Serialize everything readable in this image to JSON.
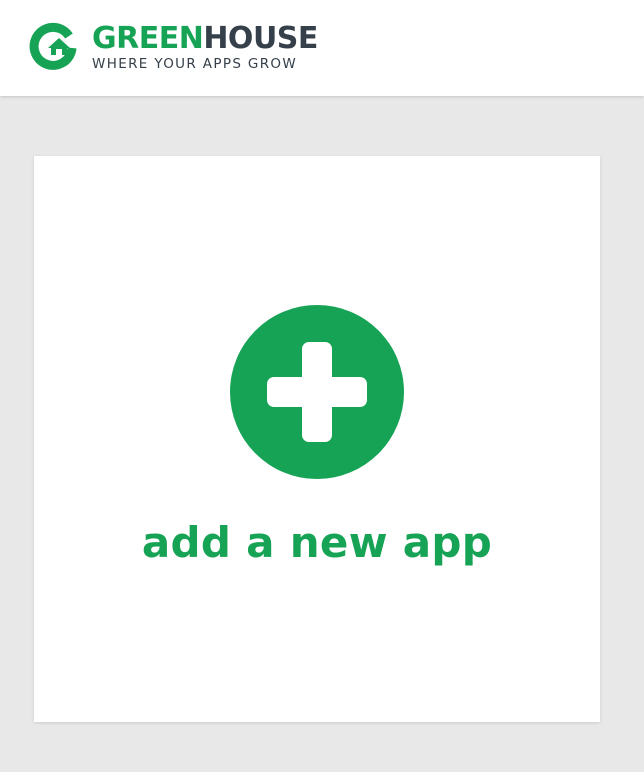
{
  "header": {
    "brand_name_part1": "GREEN",
    "brand_name_part2": "HOUSE",
    "tagline": "WHERE YOUR APPS GROW",
    "logo_icon": "greenhouse-logo-icon"
  },
  "main": {
    "add_app_card": {
      "label": "add a new app",
      "icon": "plus-icon"
    }
  },
  "colors": {
    "brand_green": "#17a355",
    "brand_dark": "#36404a",
    "background": "#e8e8e8",
    "card": "#ffffff"
  }
}
